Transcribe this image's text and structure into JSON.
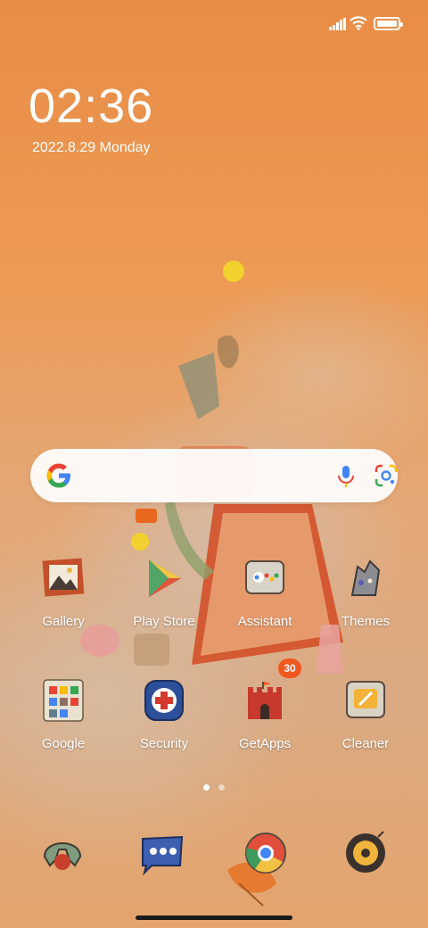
{
  "status_bar": {
    "icons": [
      "signal-icon",
      "wifi-icon",
      "battery-icon"
    ]
  },
  "lockclock": {
    "time": "02:36",
    "date": "2022.8.29 Monday"
  },
  "search_widget": {
    "icons": [
      "google-logo-icon",
      "microphone-icon",
      "google-lens-icon"
    ]
  },
  "apps": [
    {
      "label": "Gallery",
      "icon": "gallery-icon"
    },
    {
      "label": "Play Store",
      "icon": "play-store-icon"
    },
    {
      "label": "Assistant",
      "icon": "assistant-icon"
    },
    {
      "label": "Themes",
      "icon": "themes-icon"
    },
    {
      "label": "Google",
      "icon": "google-folder-icon"
    },
    {
      "label": "Security",
      "icon": "security-icon"
    },
    {
      "label": "GetApps",
      "icon": "getapps-icon",
      "badge": "30"
    },
    {
      "label": "Cleaner",
      "icon": "cleaner-icon"
    }
  ],
  "page_indicator": {
    "pages": 2,
    "current": 1
  },
  "dock": [
    {
      "icon": "phone-icon"
    },
    {
      "icon": "messages-icon"
    },
    {
      "icon": "chrome-icon"
    },
    {
      "icon": "camera-icon"
    }
  ],
  "colors": {
    "wallpaper_orange": "#e98c46",
    "badge": "#f0581f",
    "google_blue": "#4285f4",
    "google_red": "#ea4335",
    "google_yellow": "#fbbc05",
    "google_green": "#34a853"
  }
}
